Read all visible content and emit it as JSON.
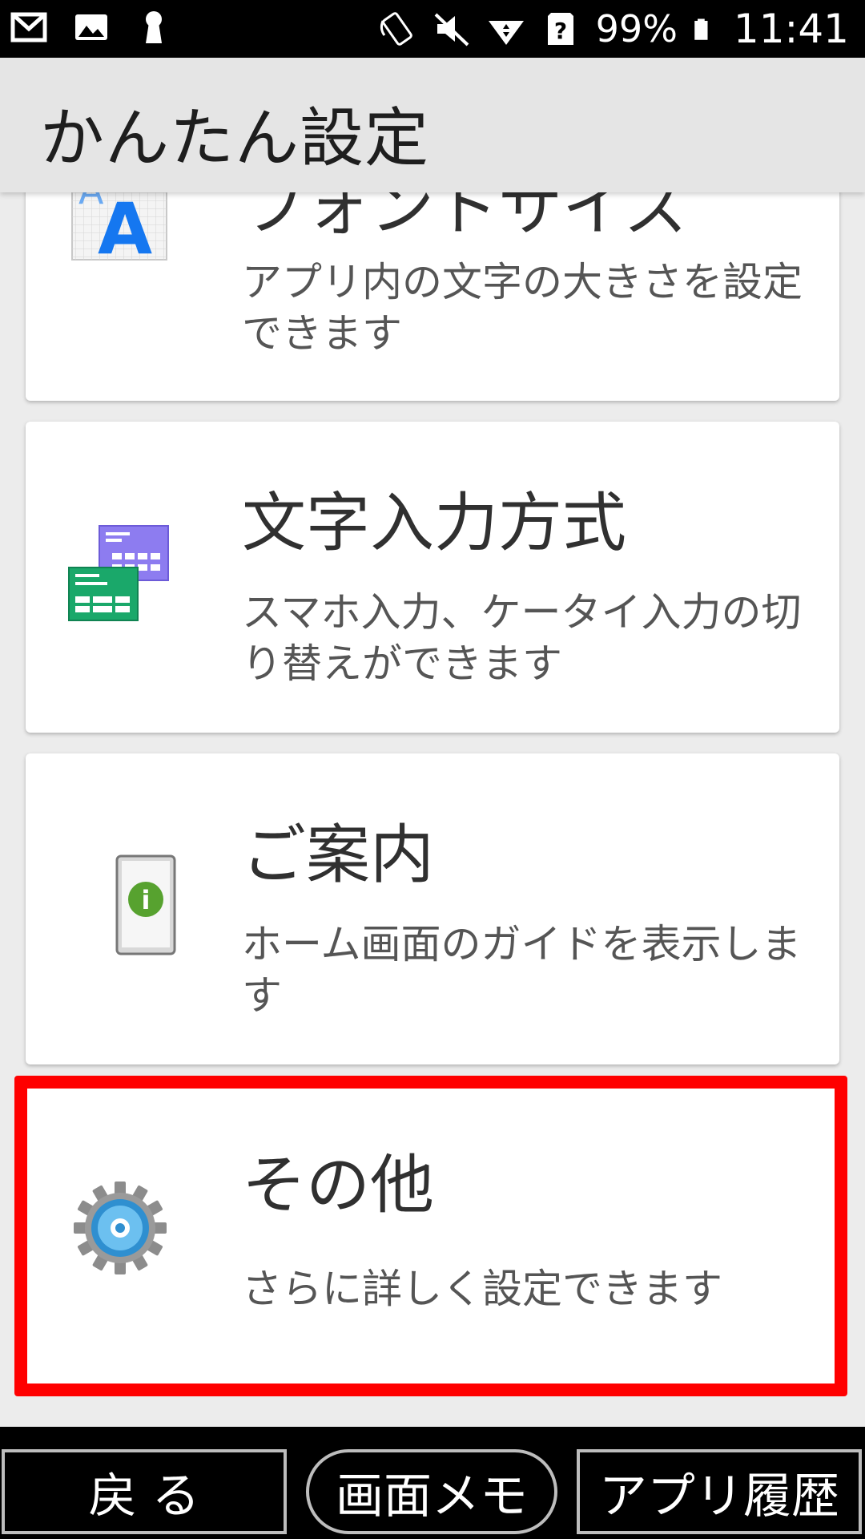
{
  "status_bar": {
    "battery": "99%",
    "time": "11:41",
    "icons": [
      "gmail-icon",
      "image-icon",
      "keyhole-icon",
      "nfc-icon",
      "mute-icon",
      "wifi-icon",
      "sim-unknown-icon",
      "battery-icon"
    ]
  },
  "header": {
    "title": "かんたん設定"
  },
  "items": [
    {
      "title": "フォントサイズ",
      "desc": "アプリ内の文字の大きさを設定できます",
      "icon": "font-size-icon"
    },
    {
      "title": "文字入力方式",
      "desc": "スマホ入力、ケータイ入力の切り替えができます",
      "icon": "keyboard-icon"
    },
    {
      "title": "ご案内",
      "desc": "ホーム画面のガイドを表示します",
      "icon": "guide-phone-icon"
    },
    {
      "title": "その他",
      "desc": "さらに詳しく設定できます",
      "icon": "gear-icon"
    }
  ],
  "bottom_nav": {
    "back": "戻 る",
    "memo": "画面メモ",
    "history": "アプリ履歴"
  },
  "colors": {
    "highlight": "#ff0000",
    "header_bg": "#e5e5e5",
    "nav_bg": "#000000"
  }
}
